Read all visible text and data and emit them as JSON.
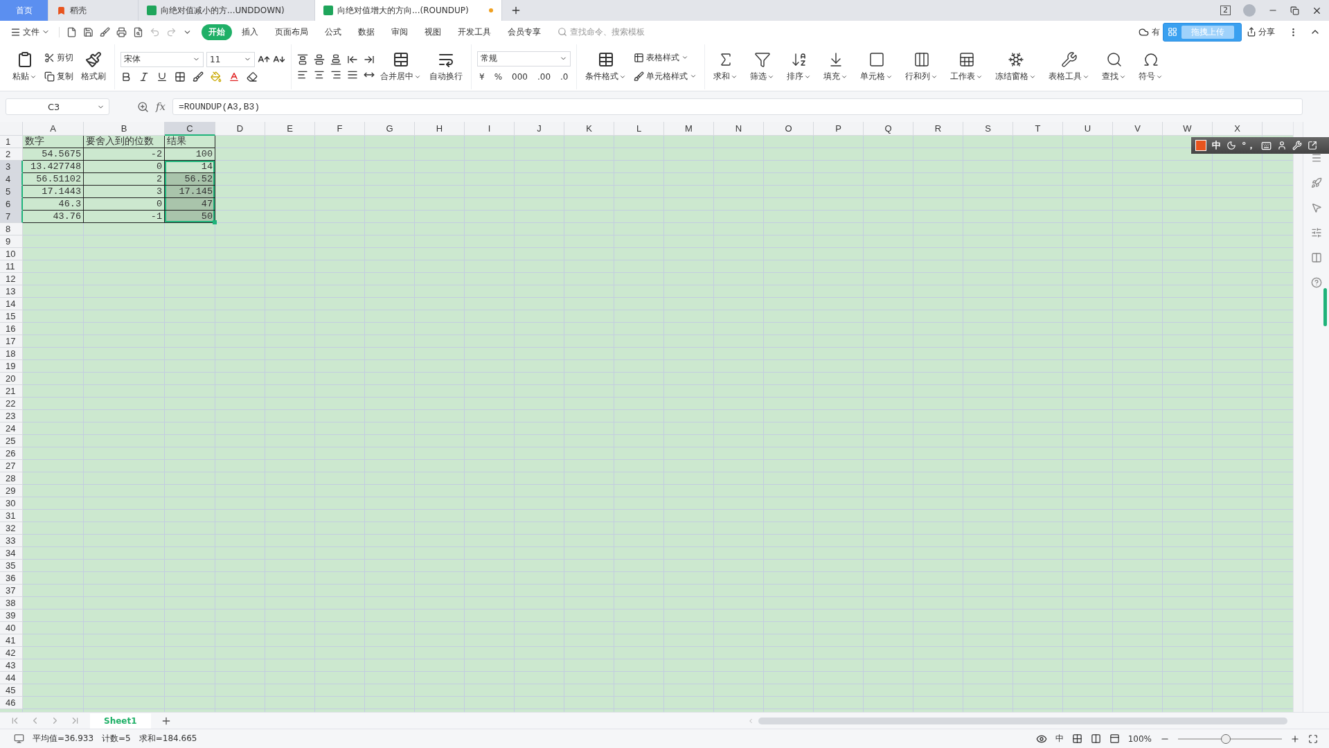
{
  "title_tabs": [
    {
      "label": "首页",
      "kind": "home",
      "selected": false,
      "unsaved": false
    },
    {
      "label": "稻壳",
      "kind": "docer",
      "selected": false,
      "unsaved": false
    },
    {
      "label": "向绝对值减小的方...UNDDOWN)",
      "kind": "sheet",
      "selected": false,
      "unsaved": false
    },
    {
      "label": "向绝对值增大的方向...(ROUNDUP)",
      "kind": "sheet",
      "selected": true,
      "unsaved": true
    }
  ],
  "window_badge": "2",
  "menu": {
    "file": "文件",
    "tabs": [
      {
        "label": "开始",
        "selected": true
      },
      {
        "label": "插入",
        "selected": false
      },
      {
        "label": "页面布局",
        "selected": false
      },
      {
        "label": "公式",
        "selected": false
      },
      {
        "label": "数据",
        "selected": false
      },
      {
        "label": "审阅",
        "selected": false
      },
      {
        "label": "视图",
        "selected": false
      },
      {
        "label": "开发工具",
        "selected": false
      },
      {
        "label": "会员专享",
        "selected": false
      }
    ],
    "search": {
      "placeholder": "查找命令、搜索模板"
    },
    "cloud_text": "有",
    "upload_popup": "拖拽上传",
    "share": "分享"
  },
  "ribbon": {
    "clipboard": {
      "paste": "粘贴",
      "cut": "剪切",
      "copy": "复制",
      "format_painter": "格式刷"
    },
    "font": {
      "name": "宋体",
      "size": "11"
    },
    "alignment": {
      "merge": "合并居中",
      "wrap": "自动换行"
    },
    "number": {
      "format": "常规",
      "currency": "¥",
      "percent": "%",
      "thousands": "000",
      "increase_decimal": ".00",
      "decrease_decimal": ".0"
    },
    "styles": {
      "table_style": "表格样式",
      "cell_style": "单元格样式",
      "conditional": "条件格式"
    },
    "tools": [
      {
        "label": "求和"
      },
      {
        "label": "筛选"
      },
      {
        "label": "排序"
      },
      {
        "label": "填充"
      },
      {
        "label": "单元格"
      },
      {
        "label": "行和列"
      },
      {
        "label": "工作表"
      },
      {
        "label": "冻结窗格"
      },
      {
        "label": "表格工具"
      },
      {
        "label": "查找"
      },
      {
        "label": "符号"
      }
    ]
  },
  "formula_bar": {
    "name_box": "C3",
    "fx": "fx",
    "formula": "=ROUNDUP(A3,B3)"
  },
  "sheet": {
    "columns": [
      {
        "label": "A",
        "selected": false
      },
      {
        "label": "B",
        "selected": false
      },
      {
        "label": "C",
        "selected": true
      },
      {
        "label": "D",
        "selected": false
      },
      {
        "label": "E",
        "selected": false
      },
      {
        "label": "F",
        "selected": false
      },
      {
        "label": "G",
        "selected": false
      },
      {
        "label": "H",
        "selected": false
      },
      {
        "label": "I",
        "selected": false
      },
      {
        "label": "J",
        "selected": false
      },
      {
        "label": "K",
        "selected": false
      },
      {
        "label": "L",
        "selected": false
      },
      {
        "label": "M",
        "selected": false
      },
      {
        "label": "N",
        "selected": false
      },
      {
        "label": "O",
        "selected": false
      },
      {
        "label": "P",
        "selected": false
      },
      {
        "label": "Q",
        "selected": false
      },
      {
        "label": "R",
        "selected": false
      },
      {
        "label": "S",
        "selected": false
      },
      {
        "label": "T",
        "selected": false
      },
      {
        "label": "U",
        "selected": false
      },
      {
        "label": "V",
        "selected": false
      },
      {
        "label": "W",
        "selected": false
      },
      {
        "label": "X",
        "selected": false
      }
    ],
    "rows": [
      {
        "number": "1",
        "selected": false,
        "cells": [
          {
            "text": "数字",
            "kind": "text",
            "selected": false
          },
          {
            "text": "要舍入到的位数",
            "kind": "text",
            "selected": false
          },
          {
            "text": "结果",
            "kind": "text",
            "selected": false
          }
        ]
      },
      {
        "number": "2",
        "selected": false,
        "cells": [
          {
            "text": "54.5675",
            "kind": "number",
            "selected": false
          },
          {
            "text": "-2",
            "kind": "number",
            "selected": false
          },
          {
            "text": "100",
            "kind": "number",
            "selected": false
          }
        ]
      },
      {
        "number": "3",
        "selected": true,
        "cells": [
          {
            "text": "13.427748",
            "kind": "number",
            "selected": false
          },
          {
            "text": "0",
            "kind": "number",
            "selected": false
          },
          {
            "text": "14",
            "kind": "number",
            "selected": true
          }
        ]
      },
      {
        "number": "4",
        "selected": true,
        "cells": [
          {
            "text": "56.51102",
            "kind": "number",
            "selected": false
          },
          {
            "text": "2",
            "kind": "number",
            "selected": false
          },
          {
            "text": "56.52",
            "kind": "number",
            "selected": true
          }
        ]
      },
      {
        "number": "5",
        "selected": true,
        "cells": [
          {
            "text": "17.1443",
            "kind": "number",
            "selected": false
          },
          {
            "text": "3",
            "kind": "number",
            "selected": false
          },
          {
            "text": "17.145",
            "kind": "number",
            "selected": true
          }
        ]
      },
      {
        "number": "6",
        "selected": true,
        "cells": [
          {
            "text": "46.3",
            "kind": "number",
            "selected": false
          },
          {
            "text": "0",
            "kind": "number",
            "selected": false
          },
          {
            "text": "47",
            "kind": "number",
            "selected": true
          }
        ]
      },
      {
        "number": "7",
        "selected": true,
        "cells": [
          {
            "text": "43.76",
            "kind": "number",
            "selected": false
          },
          {
            "text": "-1",
            "kind": "number",
            "selected": false
          },
          {
            "text": "50",
            "kind": "number",
            "selected": true
          }
        ]
      },
      {
        "number": "8",
        "selected": false
      },
      {
        "number": "9",
        "selected": false
      },
      {
        "number": "10",
        "selected": false
      },
      {
        "number": "11",
        "selected": false
      },
      {
        "number": "12",
        "selected": false
      },
      {
        "number": "13",
        "selected": false
      },
      {
        "number": "14",
        "selected": false
      },
      {
        "number": "15",
        "selected": false
      },
      {
        "number": "16",
        "selected": false
      },
      {
        "number": "17",
        "selected": false
      },
      {
        "number": "18",
        "selected": false
      },
      {
        "number": "19",
        "selected": false
      },
      {
        "number": "20",
        "selected": false
      },
      {
        "number": "21",
        "selected": false
      },
      {
        "number": "22",
        "selected": false
      },
      {
        "number": "23",
        "selected": false
      },
      {
        "number": "24",
        "selected": false
      },
      {
        "number": "25",
        "selected": false
      },
      {
        "number": "26",
        "selected": false
      },
      {
        "number": "27",
        "selected": false
      },
      {
        "number": "28",
        "selected": false
      },
      {
        "number": "29",
        "selected": false
      },
      {
        "number": "30",
        "selected": false
      },
      {
        "number": "31",
        "selected": false
      },
      {
        "number": "32",
        "selected": false
      },
      {
        "number": "33",
        "selected": false
      },
      {
        "number": "34",
        "selected": false
      },
      {
        "number": "35",
        "selected": false
      },
      {
        "number": "36",
        "selected": false
      },
      {
        "number": "37",
        "selected": false
      },
      {
        "number": "38",
        "selected": false
      },
      {
        "number": "39",
        "selected": false
      },
      {
        "number": "40",
        "selected": false
      },
      {
        "number": "41",
        "selected": false
      },
      {
        "number": "42",
        "selected": false
      },
      {
        "number": "43",
        "selected": false
      },
      {
        "number": "44",
        "selected": false
      },
      {
        "number": "45",
        "selected": false
      },
      {
        "number": "46",
        "selected": false
      }
    ]
  },
  "ime_toolbar": {
    "mode": "中",
    "punctuation": "°，"
  },
  "sheet_tabs": [
    {
      "label": "Sheet1",
      "selected": true
    }
  ],
  "status_bar": {
    "stats": [
      "平均值=36.933",
      "计数=5",
      "求和=184.665"
    ],
    "input_mode": "中",
    "zoom": "100%",
    "zoom_slider": {
      "level": 0.46
    }
  }
}
